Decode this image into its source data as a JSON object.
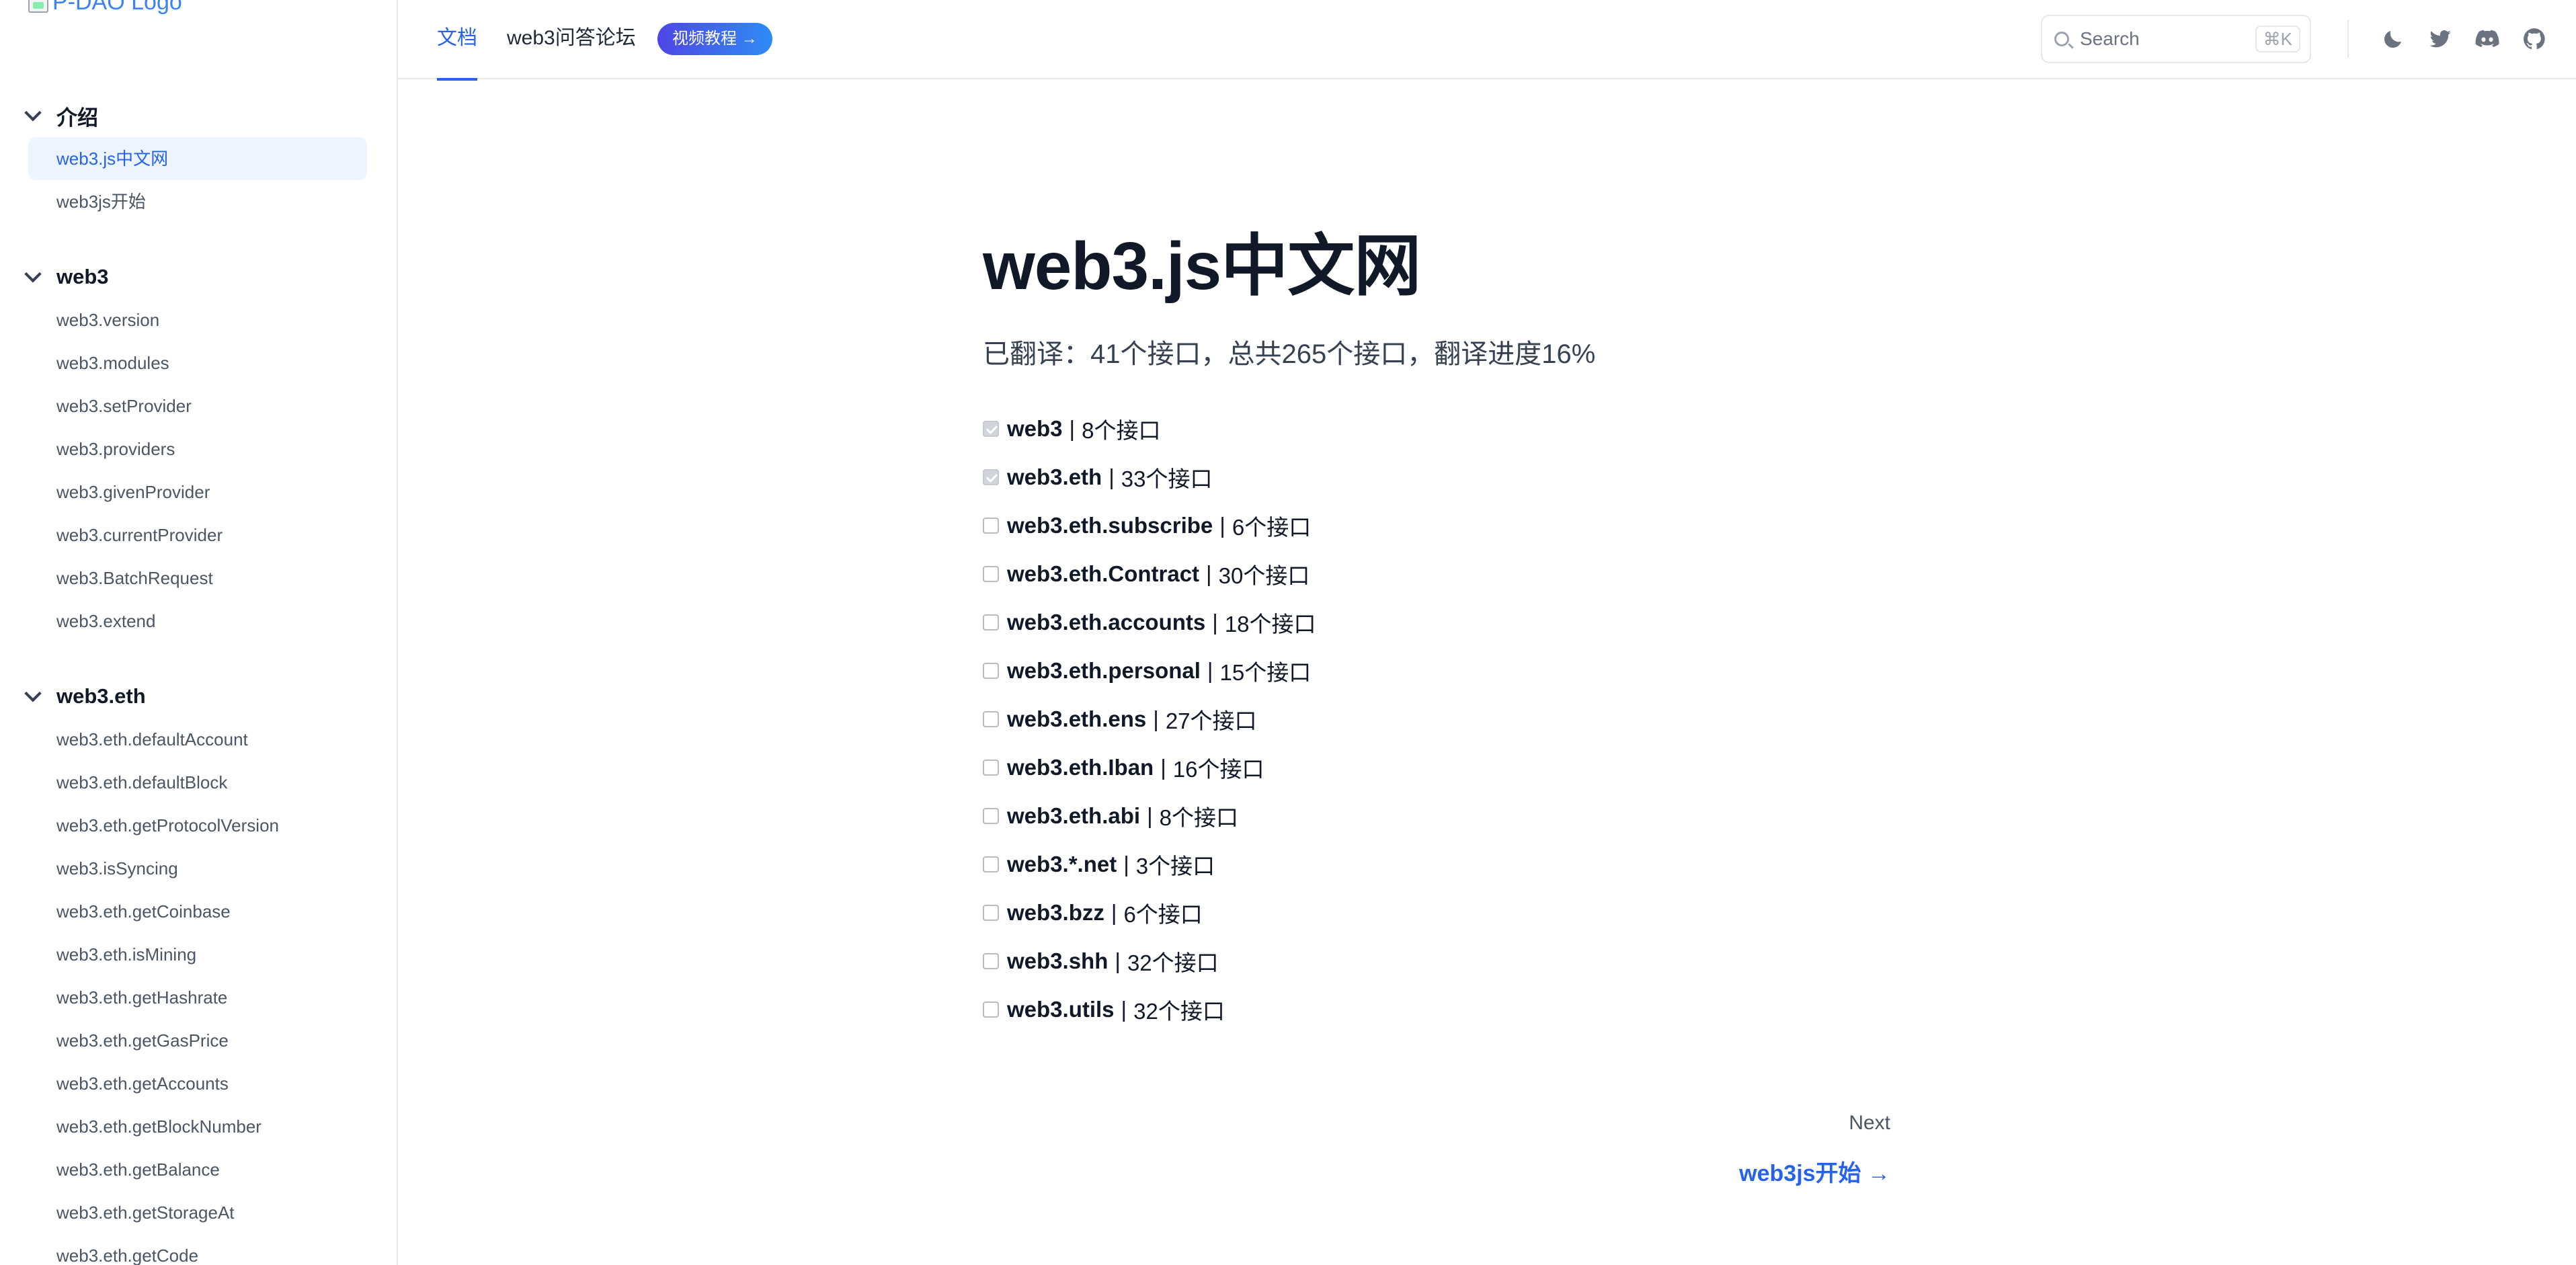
{
  "logo": {
    "alt_text": "P-DAO Logo"
  },
  "topnav": {
    "tabs": [
      {
        "label": "文档",
        "active": true
      },
      {
        "label": "web3问答论坛",
        "active": false
      }
    ],
    "video_button": "视频教程 →",
    "search_placeholder": "Search",
    "search_shortcut": "⌘K",
    "icons": [
      "moon-icon",
      "twitter-icon",
      "discord-icon",
      "github-icon"
    ]
  },
  "sidebar": {
    "groups": [
      {
        "title": "介绍",
        "items": [
          {
            "label": "web3.js中文网",
            "active": true
          },
          {
            "label": "web3js开始",
            "active": false
          }
        ]
      },
      {
        "title": "web3",
        "items": [
          {
            "label": "web3.version"
          },
          {
            "label": "web3.modules"
          },
          {
            "label": "web3.setProvider"
          },
          {
            "label": "web3.providers"
          },
          {
            "label": "web3.givenProvider"
          },
          {
            "label": "web3.currentProvider"
          },
          {
            "label": "web3.BatchRequest"
          },
          {
            "label": "web3.extend"
          }
        ]
      },
      {
        "title": "web3.eth",
        "items": [
          {
            "label": "web3.eth.defaultAccount"
          },
          {
            "label": "web3.eth.defaultBlock"
          },
          {
            "label": "web3.eth.getProtocolVersion"
          },
          {
            "label": "web3.isSyncing"
          },
          {
            "label": "web3.eth.getCoinbase"
          },
          {
            "label": "web3.eth.isMining"
          },
          {
            "label": "web3.eth.getHashrate"
          },
          {
            "label": "web3.eth.getGasPrice"
          },
          {
            "label": "web3.eth.getAccounts"
          },
          {
            "label": "web3.eth.getBlockNumber"
          },
          {
            "label": "web3.eth.getBalance"
          },
          {
            "label": "web3.eth.getStorageAt"
          },
          {
            "label": "web3.eth.getCode"
          }
        ]
      }
    ]
  },
  "main": {
    "title": "web3.js中文网",
    "progress_text": "已翻译：41个接口，总共265个接口，翻译进度16%",
    "separator": "|",
    "modules": [
      {
        "name": "web3",
        "count": "8个接口",
        "checked": true
      },
      {
        "name": "web3.eth",
        "count": "33个接口",
        "checked": true
      },
      {
        "name": "web3.eth.subscribe",
        "count": "6个接口",
        "checked": false
      },
      {
        "name": "web3.eth.Contract",
        "count": "30个接口",
        "checked": false
      },
      {
        "name": "web3.eth.accounts",
        "count": "18个接口",
        "checked": false
      },
      {
        "name": "web3.eth.personal",
        "count": "15个接口",
        "checked": false
      },
      {
        "name": "web3.eth.ens",
        "count": "27个接口",
        "checked": false
      },
      {
        "name": "web3.eth.Iban",
        "count": "16个接口",
        "checked": false
      },
      {
        "name": "web3.eth.abi",
        "count": "8个接口",
        "checked": false
      },
      {
        "name": "web3.*.net",
        "count": "3个接口",
        "checked": false
      },
      {
        "name": "web3.bzz",
        "count": "6个接口",
        "checked": false
      },
      {
        "name": "web3.shh",
        "count": "32个接口",
        "checked": false
      },
      {
        "name": "web3.utils",
        "count": "32个接口",
        "checked": false
      }
    ],
    "next": {
      "label": "Next",
      "link_text": "web3js开始 →"
    }
  }
}
